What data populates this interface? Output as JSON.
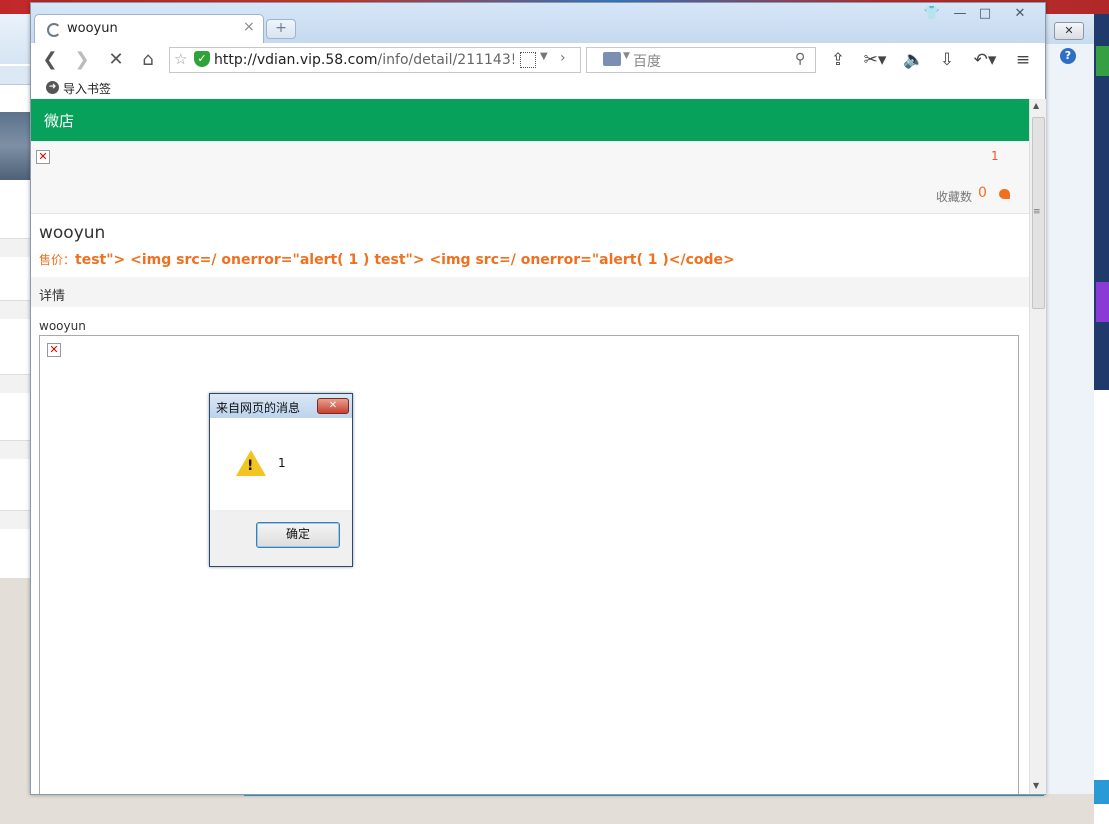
{
  "browser": {
    "tab_title": "wooyun",
    "tab_close": "×",
    "new_tab": "+",
    "window_controls": [
      "👕",
      "—",
      "□",
      "✕"
    ],
    "url_host": "http://vdian.vip.58.com",
    "url_path": "/info/detail/211143!",
    "search_placeholder": "百度",
    "bookmark_label": "导入书签",
    "page_loading": true
  },
  "page": {
    "header_title": "微店",
    "page_count": "1",
    "favorites_label": "收藏数",
    "favorites_count": "0",
    "product_name": "wooyun",
    "price_label": "售价：",
    "price_value": "test\"> <img src=/ onerror=\"alert( 1 ) test\"> <img src=/ onerror=\"alert( 1 )</code>",
    "detail_label": "详情",
    "detail_text": "wooyun",
    "broken_image_glyph": "✕",
    "accent_color": "#07a15b",
    "price_color": "#f07020"
  },
  "dialog": {
    "title": "来自网页的消息",
    "message": "1",
    "ok_label": "确定",
    "close_label": "✕"
  },
  "background": {
    "close_label": "✕",
    "help_label": "?"
  }
}
